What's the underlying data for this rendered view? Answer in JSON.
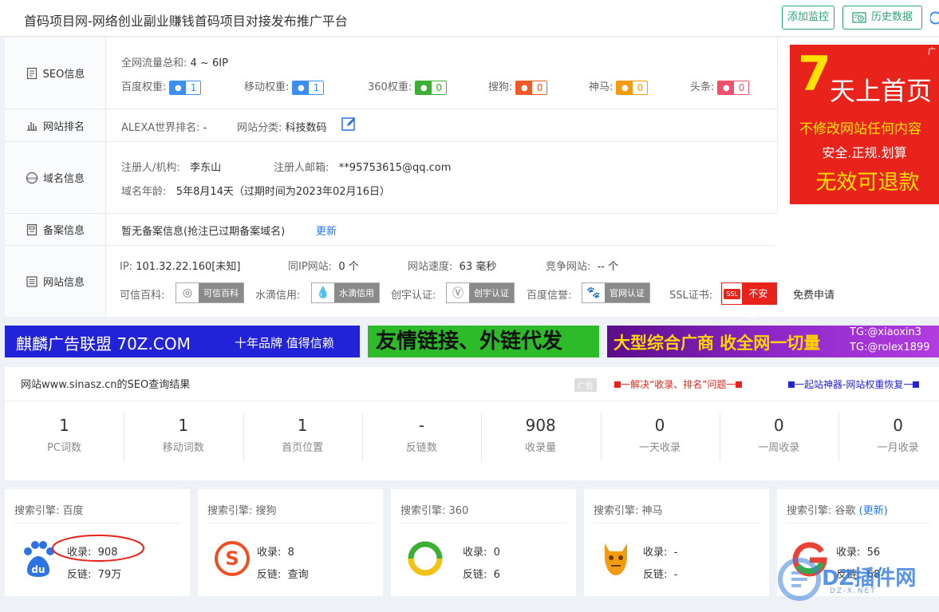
{
  "header": {
    "title": "首码项目网-网络创业副业赚钱首码项目对接发布推广平台",
    "add_monitor": "添加监控",
    "history": "历史数据"
  },
  "seo": {
    "label": "SEO信息",
    "traffic_label": "全网流量总和:",
    "traffic_value": "4 ~ 6IP",
    "weights": [
      {
        "label": "百度权重:",
        "value": "1",
        "color": "#3b8ff0",
        "icon": "baidu-paw-icon"
      },
      {
        "label": "移动权重:",
        "value": "1",
        "color": "#3b8ff0",
        "icon": "baidu-paw-icon"
      },
      {
        "label": "360权重:",
        "value": "0",
        "color": "#3cb034",
        "icon": "360-icon"
      },
      {
        "label": "搜狗:",
        "value": "0",
        "color": "#f05a28",
        "icon": "sogou-icon"
      },
      {
        "label": "神马:",
        "value": "0",
        "color": "#f39c12",
        "icon": "shenma-icon"
      },
      {
        "label": "头条:",
        "value": "0",
        "color": "#f0506e",
        "icon": "toutiao-icon"
      }
    ]
  },
  "rank": {
    "label": "网站排名",
    "alexa_label": "ALEXA世界排名:",
    "alexa_value": "-",
    "category_label": "网站分类:",
    "category_value": "科技数码"
  },
  "domain": {
    "label": "域名信息",
    "registrant_label": "注册人/机构:",
    "registrant_value": "李东山",
    "email_label": "注册人邮箱:",
    "email_value": "**95753615@qq.com",
    "age_label": "域名年龄:",
    "age_value": "5年8月14天（过期时间为2023年02月16日）"
  },
  "icp": {
    "label": "备案信息",
    "text": "暂无备案信息(抢注已过期备案域名)",
    "update": "更新"
  },
  "site": {
    "label": "网站信息",
    "ip_label": "IP:",
    "ip_value": "101.32.22.160[未知]",
    "same_ip_label": "同IP网站:",
    "same_ip_value": "0 个",
    "speed_label": "网站速度:",
    "speed_value": "63 毫秒",
    "compete_label": "竞争网站:",
    "compete_value": "-- 个",
    "baike_label": "可信百科:",
    "baike_badge": "可信百科",
    "water_label": "水滴信用:",
    "water_badge": "水滴信用",
    "chuangyu_label": "创宇认证:",
    "chuangyu_badge": "创宇认证",
    "baidu_label": "百度信誉:",
    "baidu_badge": "官网认证",
    "ssl_label": "SSL证书:",
    "ssl_badge": "不安全",
    "ssl_tag": "SSL",
    "ssl_apply": "免费申请"
  },
  "ad": {
    "corner": "广",
    "big": "7",
    "line1": "天上首页",
    "line2": "不修改网站任何内容",
    "line3": "安全.正规.划算",
    "line4": "无效可退款"
  },
  "banners": {
    "b1": "麒麟广告联盟 70Z.COM",
    "b1_small": "十年品牌 值得信赖",
    "b2": "友情链接、外链代发",
    "b3": "大型综合广商 收全网一切量",
    "b3_tg1": "TG:@xiaoxin3",
    "b3_tg2": "TG:@rolex1899"
  },
  "result": {
    "title": "网站www.sinasz.cn的SEO查询结果",
    "ad_tag": "广告",
    "link1": "一解决“收录、排名”问题一",
    "link2": "一起站神器-网站权重恢复一",
    "stats": [
      {
        "value": "1",
        "label": "PC词数"
      },
      {
        "value": "1",
        "label": "移动词数"
      },
      {
        "value": "1",
        "label": "首页位置"
      },
      {
        "value": "-",
        "label": "反链数"
      },
      {
        "value": "908",
        "label": "收录量"
      },
      {
        "value": "0",
        "label": "一天收录"
      },
      {
        "value": "0",
        "label": "一周收录"
      },
      {
        "value": "0",
        "label": "一月收录"
      }
    ]
  },
  "engines": [
    {
      "title": "搜索引擎: 百度",
      "index_label": "收录:",
      "index_value": "908",
      "link_label": "反链:",
      "link_value": "79万",
      "icon": "baidu-paw-icon",
      "color": "#2c73e4"
    },
    {
      "title": "搜索引擎: 搜狗",
      "index_label": "收录:",
      "index_value": "8",
      "link_label": "反链:",
      "link_value": "查询",
      "icon": "sogou-icon",
      "color": "#f04e23"
    },
    {
      "title": "搜索引擎: 360",
      "index_label": "收录:",
      "index_value": "0",
      "link_label": "反链:",
      "link_value": "6",
      "icon": "360-icon",
      "color": "#3cb034"
    },
    {
      "title": "搜索引擎: 神马",
      "index_label": "收录:",
      "index_value": "-",
      "link_label": "反链:",
      "link_value": "-",
      "icon": "shenma-icon",
      "color": "#f39c12"
    },
    {
      "title": "搜索引擎: 谷歌",
      "title_link": "(更新)",
      "index_label": "收录:",
      "index_value": "56",
      "link_label": "反链:",
      "link_value": "68",
      "icon": "google-icon",
      "color": "#4285f4"
    }
  ],
  "watermark": {
    "text": "DZ插件网",
    "sub": "DZ-X.NET"
  }
}
